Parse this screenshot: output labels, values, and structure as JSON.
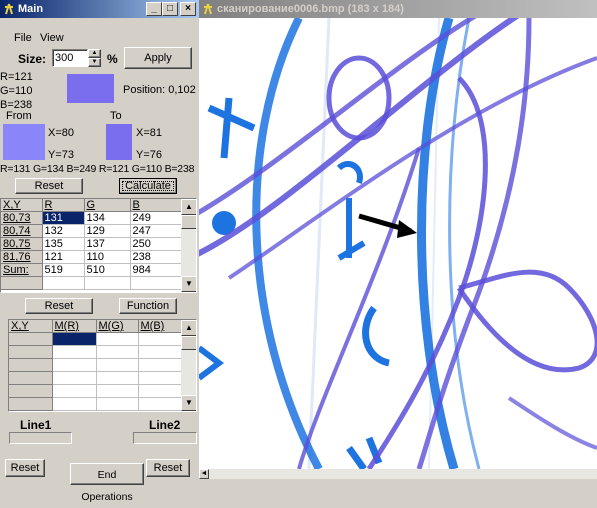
{
  "main_window": {
    "title": "Main",
    "menu": [
      "File",
      "View"
    ],
    "size_label": "Size:",
    "size_value": "300",
    "percent_label": "%",
    "apply_label": "Apply",
    "current": {
      "r": "R=121",
      "g": "G=110",
      "b": "B=238",
      "position": "Position: 0,102",
      "color": "#7b6eee"
    },
    "from": {
      "label": "From",
      "x": "X=80",
      "y": "Y=73",
      "color": "#8a86f9"
    },
    "to": {
      "label": "To",
      "x": "X=81",
      "y": "Y=76",
      "color": "#7b6eee"
    },
    "rgb_summary": "R=131 G=134 B=249  R=121 G=110 B=238",
    "reset_label": "Reset",
    "calculate_label": "Calculate",
    "table1": {
      "headers": [
        "X,Y",
        "R",
        "G",
        "B"
      ],
      "rows": [
        [
          "80,73",
          "131",
          "134",
          "249"
        ],
        [
          "80,74",
          "132",
          "129",
          "247"
        ],
        [
          "80,75",
          "135",
          "137",
          "250"
        ],
        [
          "81,76",
          "121",
          "110",
          "238"
        ],
        [
          "Sum:",
          "519",
          "510",
          "984"
        ]
      ]
    },
    "reset2_label": "Reset",
    "function_label": "Function",
    "table2": {
      "headers": [
        "X,Y",
        "M(R)",
        "M(G)",
        "M(B)"
      ]
    },
    "line1_label": "Line1",
    "line2_label": "Line2",
    "reset_left_label": "Reset",
    "end_operations_label": "End Operations",
    "reset_right_label": "Reset"
  },
  "image_window": {
    "title": "сканирование0006.bmp (183 x 184)",
    "image_alt": "blue ink drawing zoomed",
    "colors": {
      "ink_blue": "#1d73e0",
      "ink_violet": "#5a4fd8",
      "arrow": "#000000"
    }
  }
}
